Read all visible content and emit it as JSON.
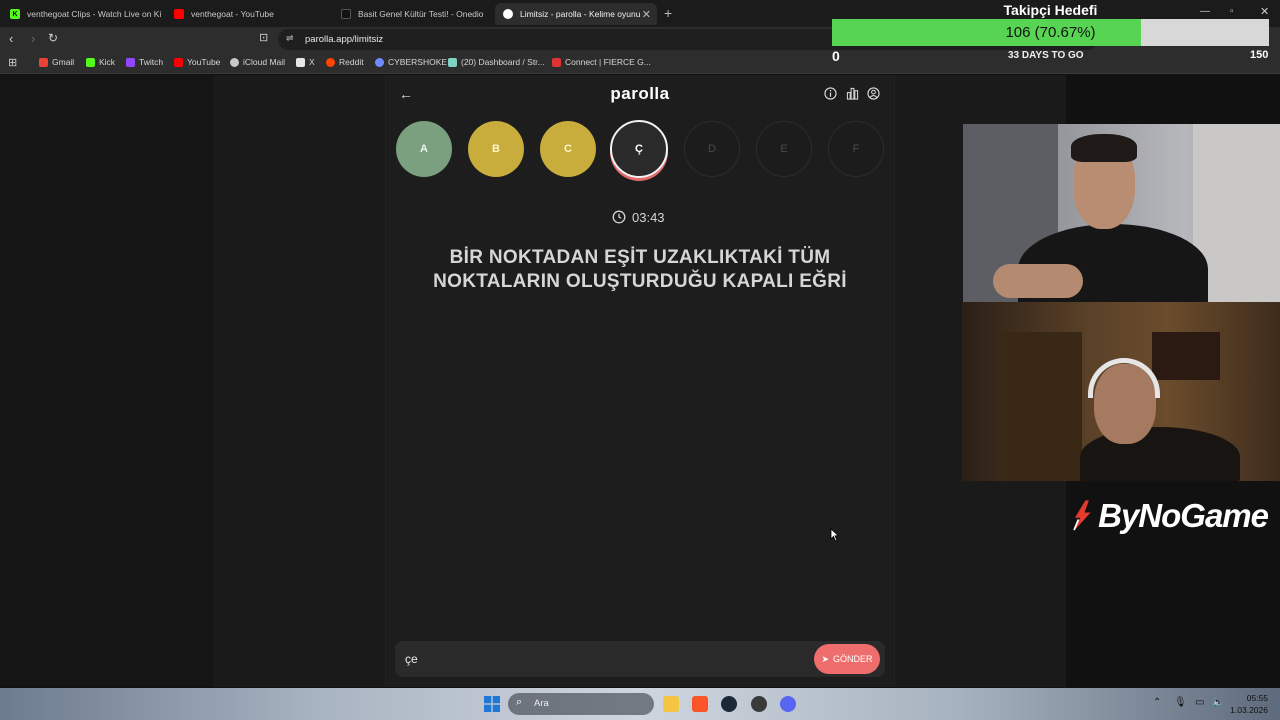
{
  "browser": {
    "tabs": [
      {
        "title": "venthegoat Clips - Watch Live on Ki",
        "icon": "kick-icon",
        "color": "#53fc18"
      },
      {
        "title": "venthegoat - YouTube",
        "icon": "youtube-icon",
        "color": "#ff0000"
      },
      {
        "title": "Basit Genel Kültür Testi! - Onedio",
        "icon": "onedio-icon",
        "color": "#111111"
      },
      {
        "title": "Limitsiz - parolla - Kelime oyunu",
        "icon": "parolla-icon",
        "color": "#ffffff",
        "active": true
      }
    ],
    "new_tab": "+",
    "url": "parolla.app/limitsiz",
    "bookmarks": [
      {
        "label": "Gmail",
        "color": "#ea4335"
      },
      {
        "label": "Kick",
        "color": "#53fc18"
      },
      {
        "label": "Twitch",
        "color": "#9146ff"
      },
      {
        "label": "YouTube",
        "color": "#ff0000"
      },
      {
        "label": "iCloud Mail",
        "color": "#c9c9c9"
      },
      {
        "label": "X",
        "color": "#e7e7e7"
      },
      {
        "label": "Reddit",
        "color": "#ff4500"
      },
      {
        "label": "CYBERSHOKE",
        "color": "#6f8cff"
      },
      {
        "label": "(20) Dashboard / Str...",
        "color": "#7fd3c4"
      },
      {
        "label": "Connect | FIERCE G...",
        "color": "#d33"
      }
    ]
  },
  "app": {
    "logo": "parolla",
    "letters": [
      {
        "letter": "A",
        "state": "correct"
      },
      {
        "letter": "B",
        "state": "passed"
      },
      {
        "letter": "C",
        "state": "passed"
      },
      {
        "letter": "Ç",
        "state": "current"
      },
      {
        "letter": "D",
        "state": "pending"
      },
      {
        "letter": "E",
        "state": "pending"
      },
      {
        "letter": "F",
        "state": "pending"
      }
    ],
    "timer": "03:43",
    "question": "BİR NOKTADAN EŞİT UZAKLIKTAKİ TÜM NOKTALARIN OLUŞTURDUĞU KAPALI EĞRİ",
    "answer_value": "çe",
    "send_label": "GÖNDER",
    "colors": {
      "correct": "#7aa07f",
      "passed": "#c8ad3c",
      "send": "#ee6e6e"
    }
  },
  "overlay": {
    "goal_title": "Takipçi Hedefi",
    "goal_text": "106 (70.67%)",
    "goal_progress": 0.7067,
    "goal_min": "0",
    "goal_days": "33 DAYS TO GO",
    "goal_max": "150",
    "brand": "ByNoGame"
  },
  "taskbar": {
    "search_label": "Ara",
    "time": "05:55",
    "date": "1.03.2026"
  }
}
